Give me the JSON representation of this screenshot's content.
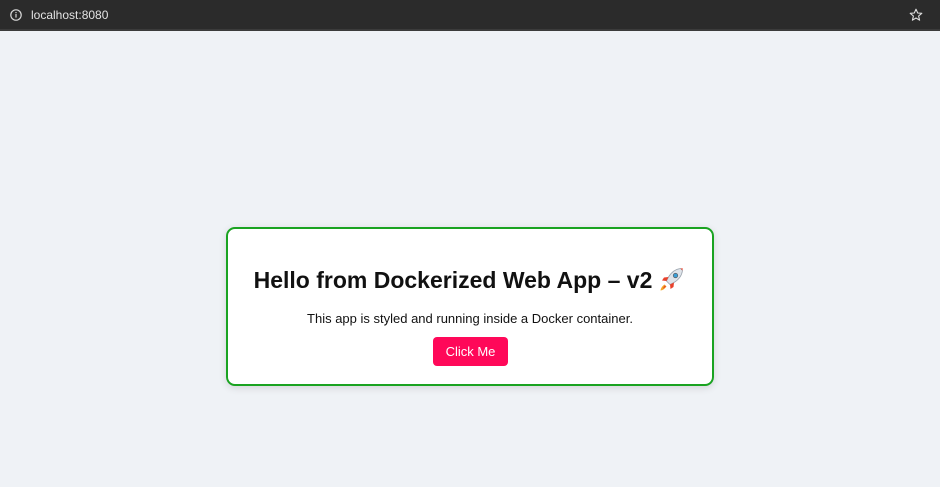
{
  "browser": {
    "url": "localhost:8080",
    "info_icon": "info-icon",
    "bookmark_icon": "star-icon"
  },
  "card": {
    "title": "Hello from Dockerized Web App – v2",
    "title_icon": "rocket-icon",
    "description": "This app is styled and running inside a Docker container.",
    "button_label": "Click Me",
    "border_color": "#1aa321",
    "button_color": "#ff0859"
  },
  "page": {
    "background_color": "#eff2f6"
  }
}
